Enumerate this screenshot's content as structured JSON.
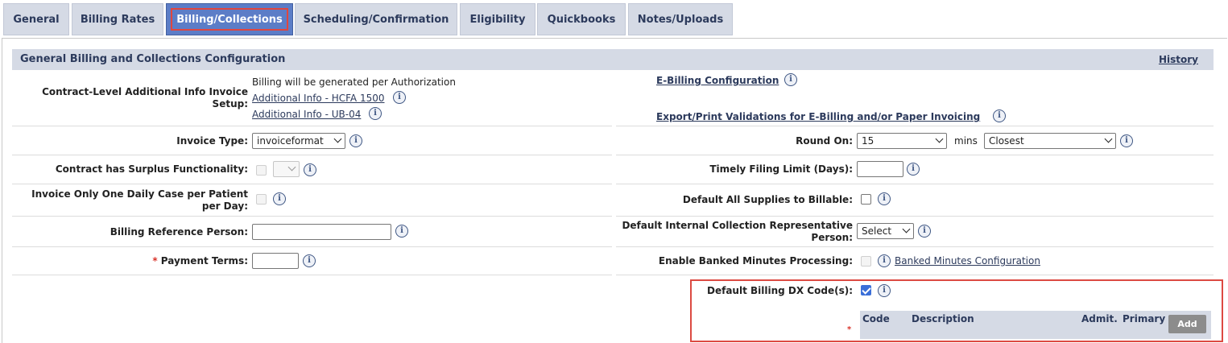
{
  "tabs": [
    {
      "label": "General"
    },
    {
      "label": "Billing Rates"
    },
    {
      "label": "Billing/Collections"
    },
    {
      "label": "Scheduling/Confirmation"
    },
    {
      "label": "Eligibility"
    },
    {
      "label": "Quickbooks"
    },
    {
      "label": "Notes/Uploads"
    }
  ],
  "section": {
    "title": "General Billing and Collections Configuration",
    "history_link": "History"
  },
  "left": {
    "contract_info": {
      "label": "Contract-Level Additional Info Invoice Setup:",
      "note": "Billing will be generated per Authorization",
      "link_hcfa": "Additional Info - HCFA 1500",
      "link_ub04": "Additional Info - UB-04"
    },
    "invoice_type": {
      "label": "Invoice Type:",
      "value": "invoiceformat"
    },
    "surplus": {
      "label": "Contract has Surplus Functionality:",
      "value": ""
    },
    "one_daily_case": {
      "label": "Invoice Only One Daily Case per Patient per Day:"
    },
    "billing_ref": {
      "label": "Billing Reference Person:",
      "value": ""
    },
    "payment_terms": {
      "label": "Payment Terms:",
      "required_mark": "*",
      "value": ""
    }
  },
  "right": {
    "ebilling_link": "E-Billing Configuration",
    "export_link": "Export/Print Validations for E-Billing and/or Paper Invoicing",
    "round_on": {
      "label": "Round On:",
      "value": "15",
      "unit": "mins",
      "mode": "Closest"
    },
    "timely_filing": {
      "label": "Timely Filing Limit (Days):",
      "value": ""
    },
    "supplies_billable": {
      "label": "Default All Supplies to Billable:",
      "checked": false
    },
    "collection_rep": {
      "label": "Default Internal Collection Representative Person:",
      "value": "Select"
    },
    "banked_minutes": {
      "label": "Enable Banked Minutes Processing:",
      "link": "Banked Minutes Configuration"
    },
    "dx_codes": {
      "label": "Default Billing DX Code(s):",
      "checked": true,
      "required_mark": "*",
      "columns": {
        "code": "Code",
        "description": "Description",
        "admit": "Admit.",
        "primary": "Primary"
      },
      "add_button": "Add"
    }
  },
  "info_glyph": "i",
  "colors": {
    "tab_bg": "#d5dae5",
    "tab_active": "#5c7dc7",
    "highlight_red": "#dc4a42",
    "link": "#2c3a5c"
  }
}
